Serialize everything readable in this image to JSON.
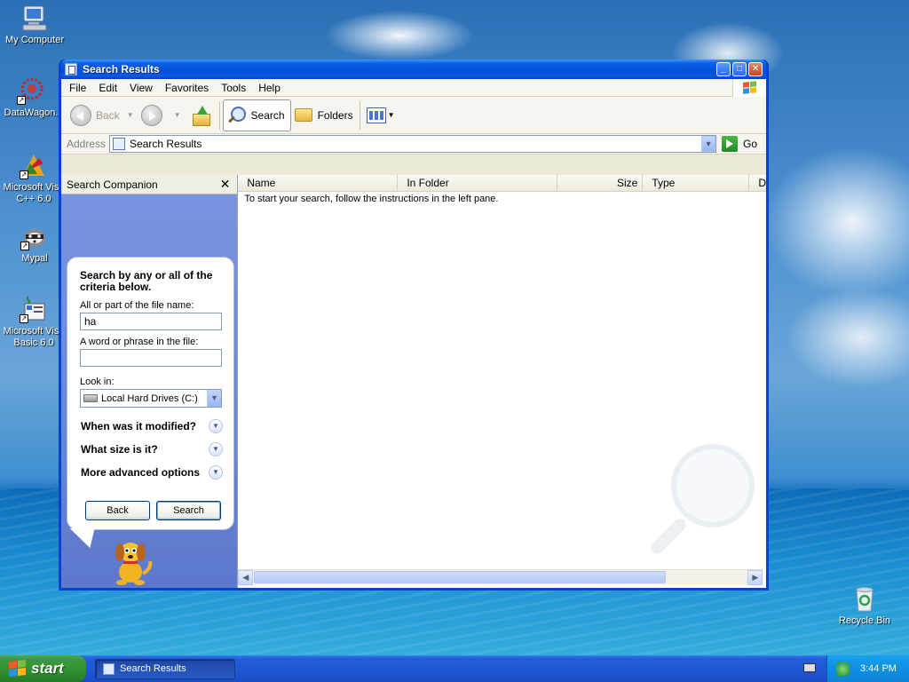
{
  "desktop": {
    "icons": [
      {
        "label": "My Computer",
        "icon": "my-computer-icon"
      },
      {
        "label": "DataWagon.",
        "icon": "datawagon-icon"
      },
      {
        "label": "Microsoft Visu C++ 6.0",
        "icon": "vcpp-icon"
      },
      {
        "label": "Mypal",
        "icon": "mypal-icon"
      },
      {
        "label": "Microsoft Visu Basic 6.0",
        "icon": "vb6-icon"
      },
      {
        "label": "Recycle Bin",
        "icon": "recycle-bin-icon"
      }
    ]
  },
  "window": {
    "title": "Search Results",
    "menu": [
      "File",
      "Edit",
      "View",
      "Favorites",
      "Tools",
      "Help"
    ],
    "toolbar": {
      "back": "Back",
      "search": "Search",
      "folders": "Folders"
    },
    "address": {
      "label": "Address",
      "value": "Search Results",
      "go": "Go"
    },
    "companion": {
      "header": "Search Companion",
      "prompt": "Search by any or all of the criteria below.",
      "filename_label": "All or part of the file name:",
      "filename_value": "ha",
      "phrase_label": "A word or phrase in the file:",
      "phrase_value": "",
      "lookin_label": "Look in:",
      "lookin_value": "Local Hard Drives (C:)",
      "options": [
        "When was it modified?",
        "What size is it?",
        "More advanced options"
      ],
      "back_button": "Back",
      "search_button": "Search"
    },
    "results": {
      "columns": [
        "Name",
        "In Folder",
        "Size",
        "Type",
        "D"
      ],
      "message": "To start your search, follow the instructions in the left pane."
    }
  },
  "taskbar": {
    "start": "start",
    "task": "Search Results",
    "clock": "3:44 PM"
  },
  "colors": {
    "title_blue": "#0450d8",
    "companion_blue": "#6a86d6",
    "start_green": "#308f30"
  }
}
